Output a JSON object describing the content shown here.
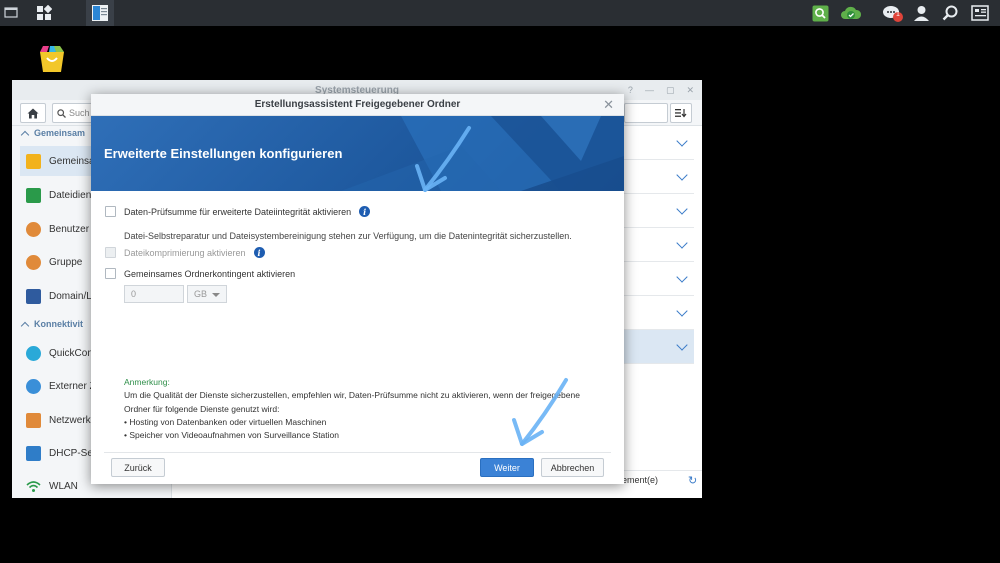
{
  "taskbar": {
    "icons": [
      "show-desktop-icon",
      "main-menu-icon",
      "control-panel-icon",
      "search-app-icon",
      "cloud-sync-icon",
      "notifications-icon",
      "user-icon",
      "search-icon",
      "widgets-icon"
    ],
    "notification_count": "1"
  },
  "control_panel": {
    "title": "Systemsteuerung",
    "search_placeholder": "Such",
    "sidebar": {
      "section1": "Gemeinsam",
      "items1": [
        {
          "label": "Gemeinsa",
          "icon": "shared-folder-icon",
          "color": "#f2b21c"
        },
        {
          "label": "Dateidien",
          "icon": "file-services-icon",
          "color": "#2a9a4a"
        },
        {
          "label": "Benutzer",
          "icon": "user-icon",
          "color": "#e08a3a"
        },
        {
          "label": "Gruppe",
          "icon": "group-icon",
          "color": "#e08a3a"
        },
        {
          "label": "Domain/L",
          "icon": "domain-icon",
          "color": "#2f5b9e"
        }
      ],
      "section2": "Konnektivit",
      "items2": [
        {
          "label": "QuickCon",
          "icon": "quickconnect-icon",
          "color": "#2aa9d8"
        },
        {
          "label": "Externer Z",
          "icon": "external-access-icon",
          "color": "#3a8fd8"
        },
        {
          "label": "Netzwerk",
          "icon": "network-icon",
          "color": "#e08a3a"
        },
        {
          "label": "DHCP-Ser",
          "icon": "dhcp-server-icon",
          "color": "#2f7dc8"
        },
        {
          "label": "WLAN",
          "icon": "wifi-icon",
          "color": "#2a9a4a"
        }
      ]
    },
    "footer_text": "ement(e)"
  },
  "dialog": {
    "title": "Erstellungsassistent Freigegebener Ordner",
    "banner_title": "Erweiterte Einstellungen konfigurieren",
    "checksum_label": "Daten-Prüfsumme für erweiterte Dateiintegrität aktivieren",
    "checksum_desc": "Datei-Selbstreparatur und Dateisystembereinigung stehen zur Verfügung, um die Datenintegrität sicherzustellen.",
    "compression_label": "Dateikomprimierung aktivieren",
    "quota_label": "Gemeinsames Ordnerkontingent aktivieren",
    "quota_value": "0",
    "quota_unit": "GB",
    "note_heading": "Anmerkung:",
    "note_text": "Um die Qualität der Dienste sicherzustellen, empfehlen wir, Daten-Prüfsumme nicht zu aktivieren, wenn der freigegebene Ordner für folgende Dienste genutzt wird:",
    "note_items": [
      "Hosting von Datenbanken oder virtuellen Maschinen",
      "Speicher von Videoaufnahmen von Surveillance Station"
    ],
    "back_label": "Zurück",
    "next_label": "Weiter",
    "cancel_label": "Abbrechen",
    "accent_color": "#3b82d6"
  }
}
